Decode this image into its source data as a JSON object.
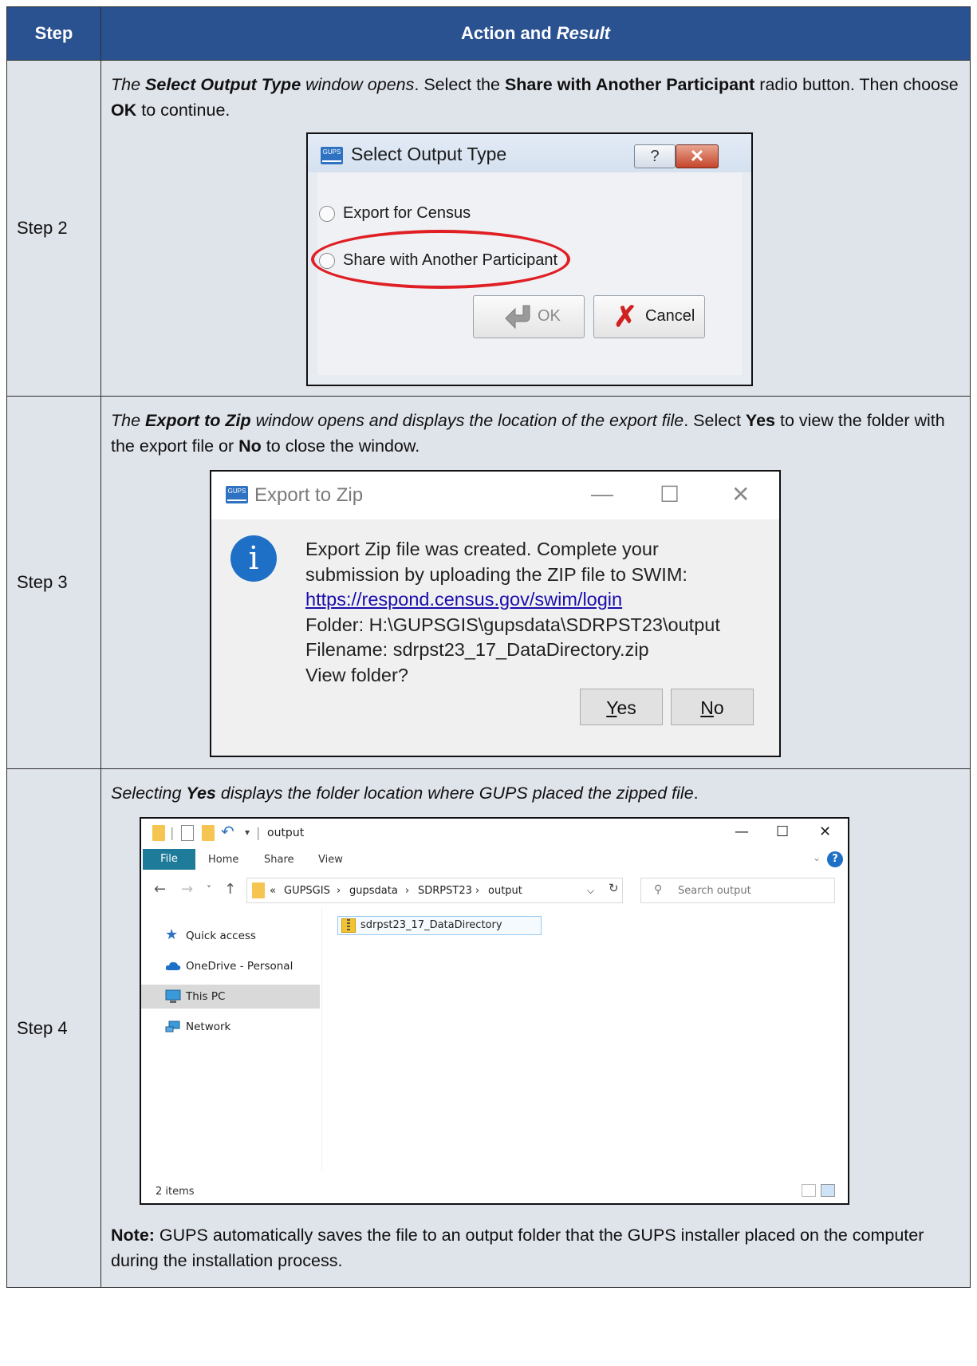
{
  "table": {
    "header_step": "Step",
    "header_action_plain": "Action and ",
    "header_action_italic": "Result"
  },
  "rows": [
    {
      "step": "Step 2",
      "text": {
        "p1": "The ",
        "p2": "Select Output Type",
        "p3": " window opens",
        "p4": ". Select the ",
        "p5": "Share with Another Participant",
        "p6": " radio button. Then choose ",
        "p7": "OK",
        "p8": " to continue."
      },
      "dialog": {
        "app_icon": "GUPS",
        "title": "Select Output Type",
        "help_glyph": "?",
        "close_glyph": "✕",
        "option_1": "Export for Census",
        "option_2": "Share with Another Participant",
        "ok_label": "OK",
        "cancel_label": "Cancel"
      }
    },
    {
      "step": "Step 3",
      "text": {
        "p1": "The ",
        "p2": "Export to Zip",
        "p3": " window opens and displays the location of the export file",
        "p4": ". Select ",
        "p5": "Yes",
        "p6": " to view the folder with the export file or ",
        "p7": "No",
        "p8": " to close the window."
      },
      "dialog": {
        "app_icon": "GUPS",
        "title": "Export to Zip",
        "minimize": "—",
        "maximize": "☐",
        "close": "✕",
        "info_glyph": "i",
        "line1": "Export Zip file was created. Complete your",
        "line2": "submission by uploading the ZIP file to SWIM:",
        "link": "https://respond.census.gov/swim/login",
        "line4": "Folder: H:\\GUPSGIS\\gupsdata\\SDRPST23\\output",
        "line5": "Filename: sdrpst23_17_DataDirectory.zip",
        "line6": "View folder?",
        "yes_access": "Y",
        "yes_rest": "es",
        "no_access": "N",
        "no_rest": "o"
      }
    },
    {
      "step": "Step 4",
      "text": {
        "p1": "Selecting ",
        "p2": "Yes",
        "p3": " displays the folder location where GUPS placed the zipped file",
        "p4": "."
      },
      "explorer": {
        "title": "output",
        "tabs": [
          "File",
          "Home",
          "Share",
          "View"
        ],
        "breadcrumb": [
          "«",
          "GUPSGIS",
          "›",
          "gupsdata",
          "›",
          "SDRPST23",
          "›",
          "output"
        ],
        "search_placeholder": "Search output",
        "nav_items": [
          "Quick access",
          "OneDrive - Personal",
          "This PC",
          "Network"
        ],
        "file_name": "sdrpst23_17_DataDirectory",
        "status": "2 items"
      },
      "note": {
        "label": "Note:",
        "text": " GUPS automatically saves the file to an output folder that the GUPS installer placed on the computer during the installation process."
      }
    }
  ],
  "colors": {
    "header_bg": "#2a5291",
    "cell_bg": "#dfe3ea",
    "highlight_red": "#e01f25",
    "explorer_file_tab": "#1f7b9a"
  }
}
